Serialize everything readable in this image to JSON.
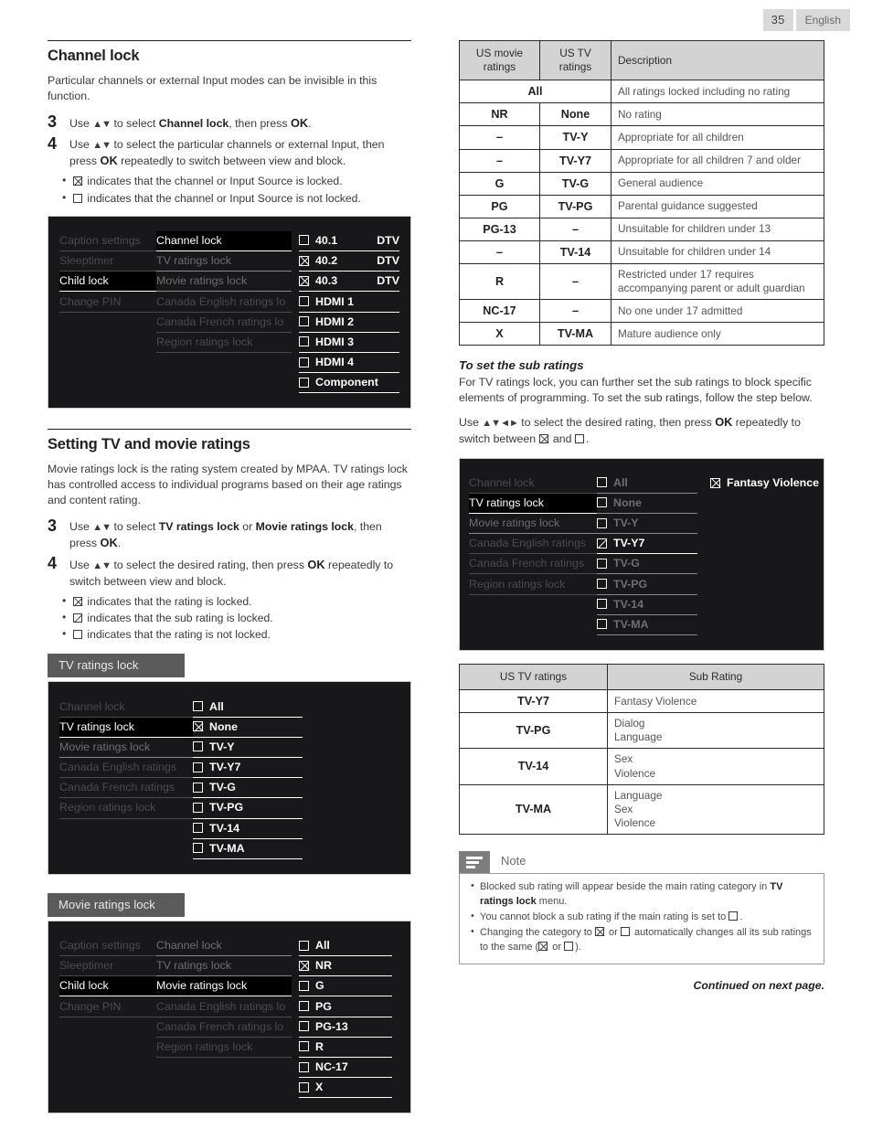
{
  "page": {
    "number": "35",
    "language": "English",
    "footer_note": "Continued on next page."
  },
  "left": {
    "section1": {
      "heading": "Channel lock",
      "intro": "Particular channels or external Input modes can be invisible in this function.",
      "steps": [
        {
          "num": "3",
          "html": "Use <span class=\"arrows\">▲▼</span> to select <b>Channel lock</b>, then press <span class=\"ok\">OK</span>."
        },
        {
          "num": "4",
          "html": "Use <span class=\"arrows\">▲▼</span> to select the particular channels or external Input, then press <span class=\"ok\">OK</span> repeatedly to switch between view and block."
        }
      ],
      "bullets": [
        {
          "box": "x",
          "text": "indicates that the channel or Input Source is locked."
        },
        {
          "box": "empty",
          "text": "indicates that the channel or Input Source is not locked."
        }
      ],
      "osd": {
        "menu_col1": [
          {
            "label": "Caption settings",
            "state": "dim"
          },
          {
            "label": "Sleeptimer",
            "state": "dim"
          },
          {
            "label": "Child lock",
            "state": "on"
          },
          {
            "label": "Change PIN",
            "state": "dim"
          }
        ],
        "menu_col2": [
          {
            "label": "Channel lock",
            "state": "on"
          },
          {
            "label": "TV ratings lock",
            "state": "dim2"
          },
          {
            "label": "Movie ratings lock",
            "state": "dim2"
          },
          {
            "label": "Canada English ratings lo",
            "state": "dim"
          },
          {
            "label": "Canada French ratings lo",
            "state": "dim"
          },
          {
            "label": "Region ratings lock",
            "state": "dim"
          }
        ],
        "options": [
          {
            "box": "empty",
            "label": "40.1",
            "right": "DTV"
          },
          {
            "box": "x",
            "label": "40.2",
            "right": "DTV"
          },
          {
            "box": "x",
            "label": "40.3",
            "right": "DTV"
          },
          {
            "box": "empty",
            "label": "HDMI 1",
            "right": ""
          },
          {
            "box": "empty",
            "label": "HDMI 2",
            "right": ""
          },
          {
            "box": "empty",
            "label": "HDMI 3",
            "right": ""
          },
          {
            "box": "empty",
            "label": "HDMI 4",
            "right": ""
          },
          {
            "box": "empty",
            "label": "Component",
            "right": ""
          }
        ]
      }
    },
    "section2": {
      "heading": "Setting TV and movie ratings",
      "intro": "Movie ratings lock is the rating system created by MPAA. TV ratings lock has controlled access to individual programs based on their age ratings and content rating.",
      "steps": [
        {
          "num": "3",
          "html": "Use <span class=\"arrows\">▲▼</span> to select <b>TV ratings lock</b> or <b>Movie ratings lock</b>, then press <span class=\"ok\">OK</span>."
        },
        {
          "num": "4",
          "html": "Use <span class=\"arrows\">▲▼</span> to select the desired rating, then press <span class=\"ok\">OK</span> repeatedly to switch between view and block."
        }
      ],
      "bullets": [
        {
          "box": "x",
          "text": "indicates that the rating is locked."
        },
        {
          "box": "half",
          "text": "indicates that the sub rating is locked."
        },
        {
          "box": "empty",
          "text": "indicates that the rating is not locked."
        }
      ],
      "osd_tv": {
        "title": "TV ratings lock",
        "menu": [
          {
            "label": "Channel lock",
            "state": "dim"
          },
          {
            "label": "TV ratings lock",
            "state": "on"
          },
          {
            "label": "Movie ratings lock",
            "state": "dim2"
          },
          {
            "label": "Canada English ratings",
            "state": "dim"
          },
          {
            "label": "Canada French ratings",
            "state": "dim"
          },
          {
            "label": "Region ratings lock",
            "state": "dim"
          }
        ],
        "options": [
          {
            "box": "empty",
            "label": "All"
          },
          {
            "box": "x",
            "label": "None"
          },
          {
            "box": "empty",
            "label": "TV-Y"
          },
          {
            "box": "empty",
            "label": "TV-Y7"
          },
          {
            "box": "empty",
            "label": "TV-G"
          },
          {
            "box": "empty",
            "label": "TV-PG"
          },
          {
            "box": "empty",
            "label": "TV-14"
          },
          {
            "box": "empty",
            "label": "TV-MA"
          }
        ]
      },
      "osd_movie": {
        "title": "Movie ratings lock",
        "menu_col1": [
          {
            "label": "Caption settings",
            "state": "dim"
          },
          {
            "label": "Sleeptimer",
            "state": "dim"
          },
          {
            "label": "Child lock",
            "state": "on"
          },
          {
            "label": "Change PIN",
            "state": "dim"
          }
        ],
        "menu_col2": [
          {
            "label": "Channel lock",
            "state": "dim2"
          },
          {
            "label": "TV ratings lock",
            "state": "dim2"
          },
          {
            "label": "Movie ratings lock",
            "state": "on"
          },
          {
            "label": "Canada English ratings lo",
            "state": "dim"
          },
          {
            "label": "Canada French ratings lo",
            "state": "dim"
          },
          {
            "label": "Region ratings lock",
            "state": "dim"
          }
        ],
        "options": [
          {
            "box": "empty",
            "label": "All"
          },
          {
            "box": "x",
            "label": "NR"
          },
          {
            "box": "empty",
            "label": "G"
          },
          {
            "box": "empty",
            "label": "PG"
          },
          {
            "box": "empty",
            "label": "PG-13"
          },
          {
            "box": "empty",
            "label": "R"
          },
          {
            "box": "empty",
            "label": "NC-17"
          },
          {
            "box": "empty",
            "label": "X"
          }
        ]
      }
    }
  },
  "right": {
    "ratings_table": {
      "headers": [
        "US movie ratings",
        "US TV ratings",
        "Description"
      ],
      "rows": [
        {
          "movie": "All",
          "tv": "",
          "span": true,
          "desc": "All ratings locked including no rating"
        },
        {
          "movie": "NR",
          "tv": "None",
          "span": false,
          "desc": "No rating"
        },
        {
          "movie": "–",
          "tv": "TV-Y",
          "span": false,
          "desc": "Appropriate for all children"
        },
        {
          "movie": "–",
          "tv": "TV-Y7",
          "span": false,
          "desc": "Appropriate for all children 7 and older"
        },
        {
          "movie": "G",
          "tv": "TV-G",
          "span": false,
          "desc": "General audience"
        },
        {
          "movie": "PG",
          "tv": "TV-PG",
          "span": false,
          "desc": "Parental guidance suggested"
        },
        {
          "movie": "PG-13",
          "tv": "–",
          "span": false,
          "desc": "Unsuitable for children under 13"
        },
        {
          "movie": "–",
          "tv": "TV-14",
          "span": false,
          "desc": "Unsuitable for children under 14"
        },
        {
          "movie": "R",
          "tv": "–",
          "span": false,
          "desc": "Restricted under 17 requires accompanying parent or adult guardian"
        },
        {
          "movie": "NC-17",
          "tv": "–",
          "span": false,
          "desc": "No one under 17 admitted"
        },
        {
          "movie": "X",
          "tv": "TV-MA",
          "span": false,
          "desc": "Mature audience only"
        }
      ]
    },
    "sub_section": {
      "heading": "To set the sub ratings",
      "intro": "For TV ratings lock, you can further set the sub ratings to block specific elements of programming. To set the sub ratings, follow the step below.",
      "instruction_html": "Use <span class=\"arrows\">▲▼◄►</span> to select the desired rating, then press <span class=\"ok\">OK</span> repeatedly to switch between <span class=\"cbx x\"></span> and <span class=\"cbx\"></span>.",
      "osd": {
        "menu": [
          {
            "label": "Channel lock",
            "state": "dim"
          },
          {
            "label": "TV ratings lock",
            "state": "on"
          },
          {
            "label": "Movie ratings lock",
            "state": "dim2"
          },
          {
            "label": "Canada English ratings",
            "state": "dim"
          },
          {
            "label": "Canada French ratings",
            "state": "dim"
          },
          {
            "label": "Region ratings lock",
            "state": "dim"
          }
        ],
        "options": [
          {
            "box": "empty",
            "label": "All",
            "state": "dim2"
          },
          {
            "box": "empty",
            "label": "None",
            "state": "dim2"
          },
          {
            "box": "empty",
            "label": "TV-Y",
            "state": "dim2"
          },
          {
            "box": "half",
            "label": "TV-Y7",
            "state": "on"
          },
          {
            "box": "empty",
            "label": "TV-G",
            "state": "dim2"
          },
          {
            "box": "empty",
            "label": "TV-PG",
            "state": "dim2"
          },
          {
            "box": "empty",
            "label": "TV-14",
            "state": "dim2"
          },
          {
            "box": "empty",
            "label": "TV-MA",
            "state": "dim2"
          }
        ],
        "sub": [
          {
            "box": "x",
            "label": "Fantasy Violence"
          }
        ]
      }
    },
    "sub_table": {
      "headers": [
        "US TV ratings",
        "Sub Rating"
      ],
      "rows": [
        {
          "rating": "TV-Y7",
          "subs": [
            "Fantasy Violence"
          ]
        },
        {
          "rating": "TV-PG",
          "subs": [
            "Dialog",
            "Language"
          ]
        },
        {
          "rating": "TV-14",
          "subs": [
            "Sex",
            "Violence"
          ]
        },
        {
          "rating": "TV-MA",
          "subs": [
            "Language",
            "Sex",
            "Violence"
          ]
        }
      ]
    },
    "note": {
      "label": "Note",
      "items": [
        "Blocked sub rating will appear beside the main rating category in <b>TV ratings lock</b> menu.",
        "You cannot block a sub rating if the main rating is set to <span class=\"cbx\"></span>.",
        "Changing the category to <span class=\"cbx x\"></span> or <span class=\"cbx\"></span> automatically changes all its sub ratings to the same (<span class=\"cbx x\"></span> or <span class=\"cbx\"></span>)."
      ]
    }
  }
}
